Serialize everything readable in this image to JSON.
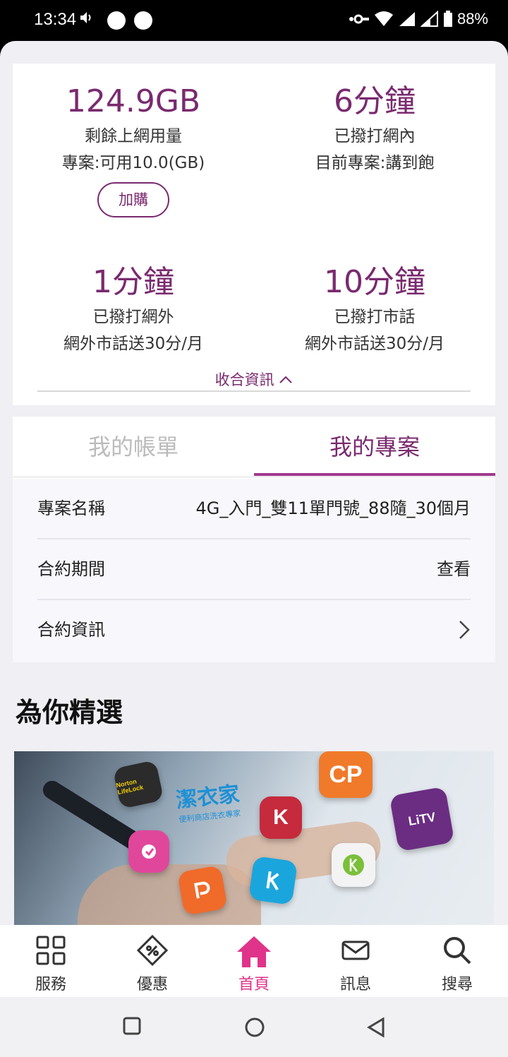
{
  "status_bar": {
    "time": "13:34",
    "battery": "88%"
  },
  "usage": {
    "data": {
      "value": "124.9GB",
      "label": "剩餘上網用量",
      "detail": "專案:可用10.0(GB)",
      "button": "加購"
    },
    "on_net": {
      "value": "6分鐘",
      "label": "已撥打網內",
      "detail": "目前專案:講到飽"
    },
    "off_net": {
      "value": "1分鐘",
      "label": "已撥打網外",
      "detail": "網外市話送30分/月"
    },
    "landline": {
      "value": "10分鐘",
      "label": "已撥打市話",
      "detail": "網外市話送30分/月"
    },
    "collapse_label": "收合資訊"
  },
  "tabs": {
    "bill": "我的帳單",
    "plan": "我的專案",
    "active": "plan"
  },
  "plan_rows": [
    {
      "key": "專案名稱",
      "value": "4G_入門_雙11單門號_88隨_30個月"
    },
    {
      "key": "合約期間",
      "value": "查看"
    },
    {
      "key": "合約資訊",
      "value": ""
    }
  ],
  "featured": {
    "title": "為你精選",
    "banner_brands": [
      "Norton LifeLock",
      "潔衣家",
      "便利商店洗衣專家",
      "CP",
      "LiTV",
      "K"
    ]
  },
  "bottom_nav": [
    {
      "label": "服務",
      "icon": "grid-icon"
    },
    {
      "label": "優惠",
      "icon": "coupon-icon"
    },
    {
      "label": "首頁",
      "icon": "home-icon"
    },
    {
      "label": "訊息",
      "icon": "mail-icon"
    },
    {
      "label": "搜尋",
      "icon": "search-icon"
    }
  ],
  "colors": {
    "accent": "#7a2a6f",
    "home_active": "#e0338a"
  }
}
